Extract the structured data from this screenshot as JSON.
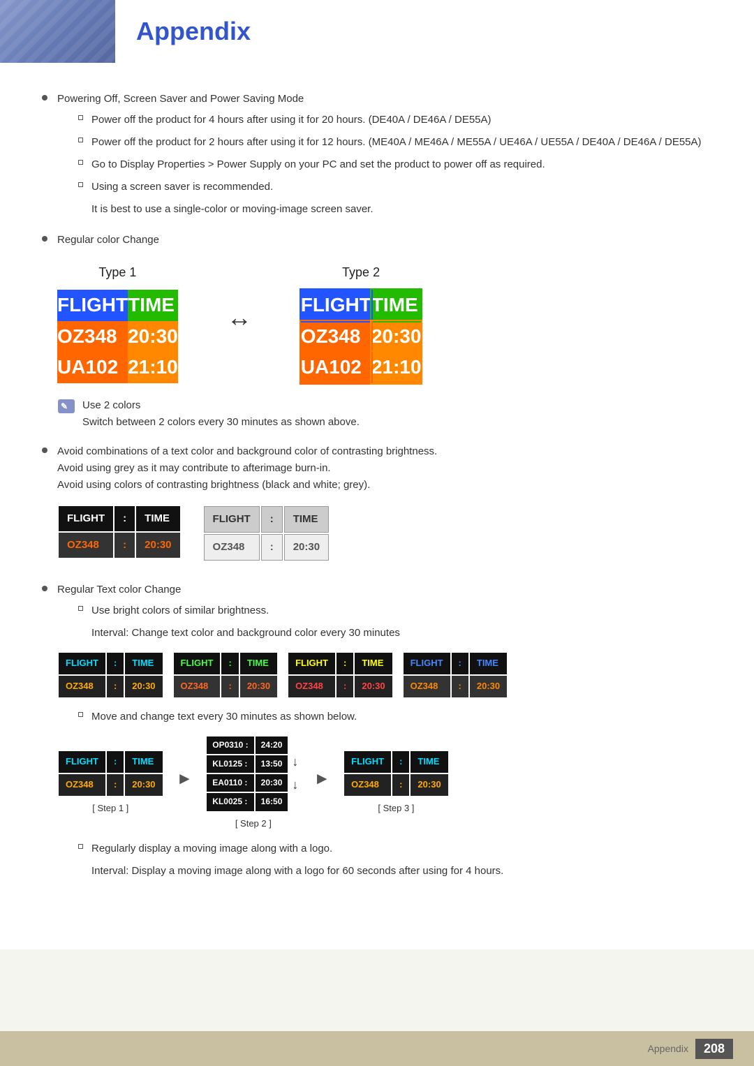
{
  "page": {
    "title": "Appendix",
    "page_number": "208",
    "footer_label": "Appendix"
  },
  "header": {
    "accent_color": "#6677bb"
  },
  "content": {
    "bullet1": {
      "text": "Powering Off, Screen Saver and Power Saving Mode",
      "sub_items": [
        "Power off the product for 4 hours after using it for 20 hours. (DE40A / DE46A / DE55A)",
        "Power off the product for 2 hours after using it for 12 hours. (ME40A / ME46A / ME55A / UE46A / UE55A / DE40A / DE46A / DE55A)",
        "Go to Display Properties > Power Supply on your PC and set the product to power off as required.",
        "Using a screen saver is recommended."
      ],
      "sub_indent": "It is best to use a single-color or moving-image screen saver."
    },
    "bullet2": {
      "text": "Regular color Change"
    },
    "type1": {
      "label": "Type 1",
      "rows": [
        {
          "col1": "FLIGHT",
          "col2": "TIME"
        },
        {
          "col1": "OZ348",
          "col2": "20:30"
        },
        {
          "col1": "UA102",
          "col2": "21:10"
        }
      ]
    },
    "type2": {
      "label": "Type 2",
      "rows": [
        {
          "col1": "FLIGHT",
          "col2": "TIME"
        },
        {
          "col1": "OZ348",
          "col2": "20:30"
        },
        {
          "col1": "UA102",
          "col2": "21:10"
        }
      ]
    },
    "note": {
      "use_2_colors": "Use 2 colors",
      "switch_text": "Switch between 2 colors every 30 minutes as shown above."
    },
    "bullet3": {
      "text": "Avoid combinations of a text color and background color of contrasting brightness.",
      "line2": "Avoid using grey as it may contribute to afterimage burn-in.",
      "line3": "Avoid using colors of contrasting brightness (black and white; grey)."
    },
    "dark_example": {
      "header1": "FLIGHT",
      "colon1": ":",
      "header2": "TIME",
      "row1": "OZ348",
      "colon2": ":",
      "row2": "20:30"
    },
    "grey_example": {
      "header1": "FLIGHT",
      "colon1": ":",
      "header2": "TIME",
      "row1": "OZ348",
      "colon2": ":",
      "row2": "20:30"
    },
    "bullet4": {
      "text": "Regular Text color Change",
      "sub1": "Use bright colors of similar brightness.",
      "sub2": "Interval: Change text color and background color every 30 minutes"
    },
    "color_variants": [
      {
        "header1": "FLIGHT",
        "sep": ":",
        "header2": "TIME",
        "row1": "OZ348",
        "sep2": ":",
        "row2": "20:30"
      },
      {
        "header1": "FLIGHT",
        "sep": ":",
        "header2": "TIME",
        "row1": "OZ348",
        "sep2": ":",
        "row2": "20:30"
      },
      {
        "header1": "FLIGHT",
        "sep": ":",
        "header2": "TIME",
        "row1": "OZ348",
        "sep2": ":",
        "row2": "20:30"
      },
      {
        "header1": "FLIGHT",
        "sep": ":",
        "header2": "TIME",
        "row1": "OZ348",
        "sep2": ":",
        "row2": "20:30"
      }
    ],
    "sub_move": "Move and change text every 30 minutes as shown below.",
    "step1": {
      "label": "[ Step 1 ]",
      "header1": "FLIGHT",
      "colon1": ":",
      "header2": "TIME",
      "row1": "OZ348",
      "colon2": ":",
      "row2": "20:30"
    },
    "step2": {
      "label": "[ Step 2 ]",
      "rows": [
        {
          "col1": "OP0310 :",
          "col2": "24:20"
        },
        {
          "col1": "KL0125 :",
          "col2": "13:50"
        },
        {
          "col1": "EA0110 :",
          "col2": "20:30"
        },
        {
          "col1": "KL0025 :",
          "col2": "16:50"
        }
      ]
    },
    "step3": {
      "label": "[ Step 3 ]",
      "header1": "FLIGHT",
      "colon1": ":",
      "header2": "TIME",
      "row1": "OZ348",
      "colon2": ":",
      "row2": "20:30"
    },
    "sub_logo": "Regularly display a moving image along with a logo.",
    "sub_logo2": "Interval: Display a moving image along with a logo for 60 seconds after using for 4 hours."
  }
}
